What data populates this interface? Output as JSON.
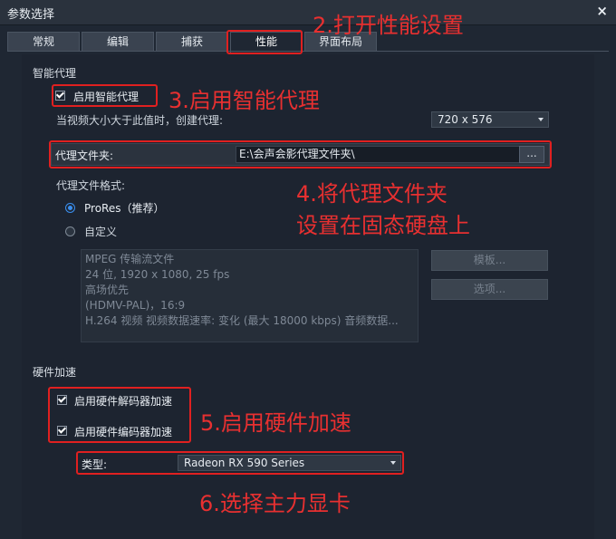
{
  "window": {
    "title": "参数选择",
    "close_glyph": "×"
  },
  "tabs": [
    {
      "label": "常规"
    },
    {
      "label": "编辑"
    },
    {
      "label": "捕获"
    },
    {
      "label": "性能"
    },
    {
      "label": "界面布局"
    }
  ],
  "active_tab": "性能",
  "smart_proxy": {
    "section_title": "智能代理",
    "enable_label": "启用智能代理",
    "enable_checked": true,
    "threshold_label": "当视频大小大于此值时，创建代理:",
    "threshold_value": "720 x 576",
    "folder_label": "代理文件夹:",
    "folder_value": "E:\\会声会影代理文件夹\\",
    "browse_label": "...",
    "format_label": "代理文件格式:",
    "formats": [
      {
        "label": "ProRes（推荐）",
        "checked": true
      },
      {
        "label": "自定义",
        "checked": false
      }
    ],
    "format_details": [
      "MPEG 传输流文件",
      "24 位, 1920 x 1080, 25 fps",
      "高场优先",
      "(HDMV-PAL)，16:9",
      "H.264 视频 视频数据速率: 变化 (最大 18000 kbps) 音频数据..."
    ],
    "template_button": "模板...",
    "options_button": "选项..."
  },
  "hardware": {
    "section_title": "硬件加速",
    "decoder_label": "启用硬件解码器加速",
    "decoder_checked": true,
    "encoder_label": "启用硬件编码器加速",
    "encoder_checked": true,
    "type_label": "类型:",
    "type_value": "Radeon RX 590 Series"
  },
  "annotations": {
    "step2": "2.打开性能设置",
    "step3": "3.启用智能代理",
    "step4_line1": "4.将代理文件夹",
    "step4_line2": "设置在固态硬盘上",
    "step5": "5.启用硬件加速",
    "step6": "6.选择主力显卡",
    "color": "#e02020"
  }
}
